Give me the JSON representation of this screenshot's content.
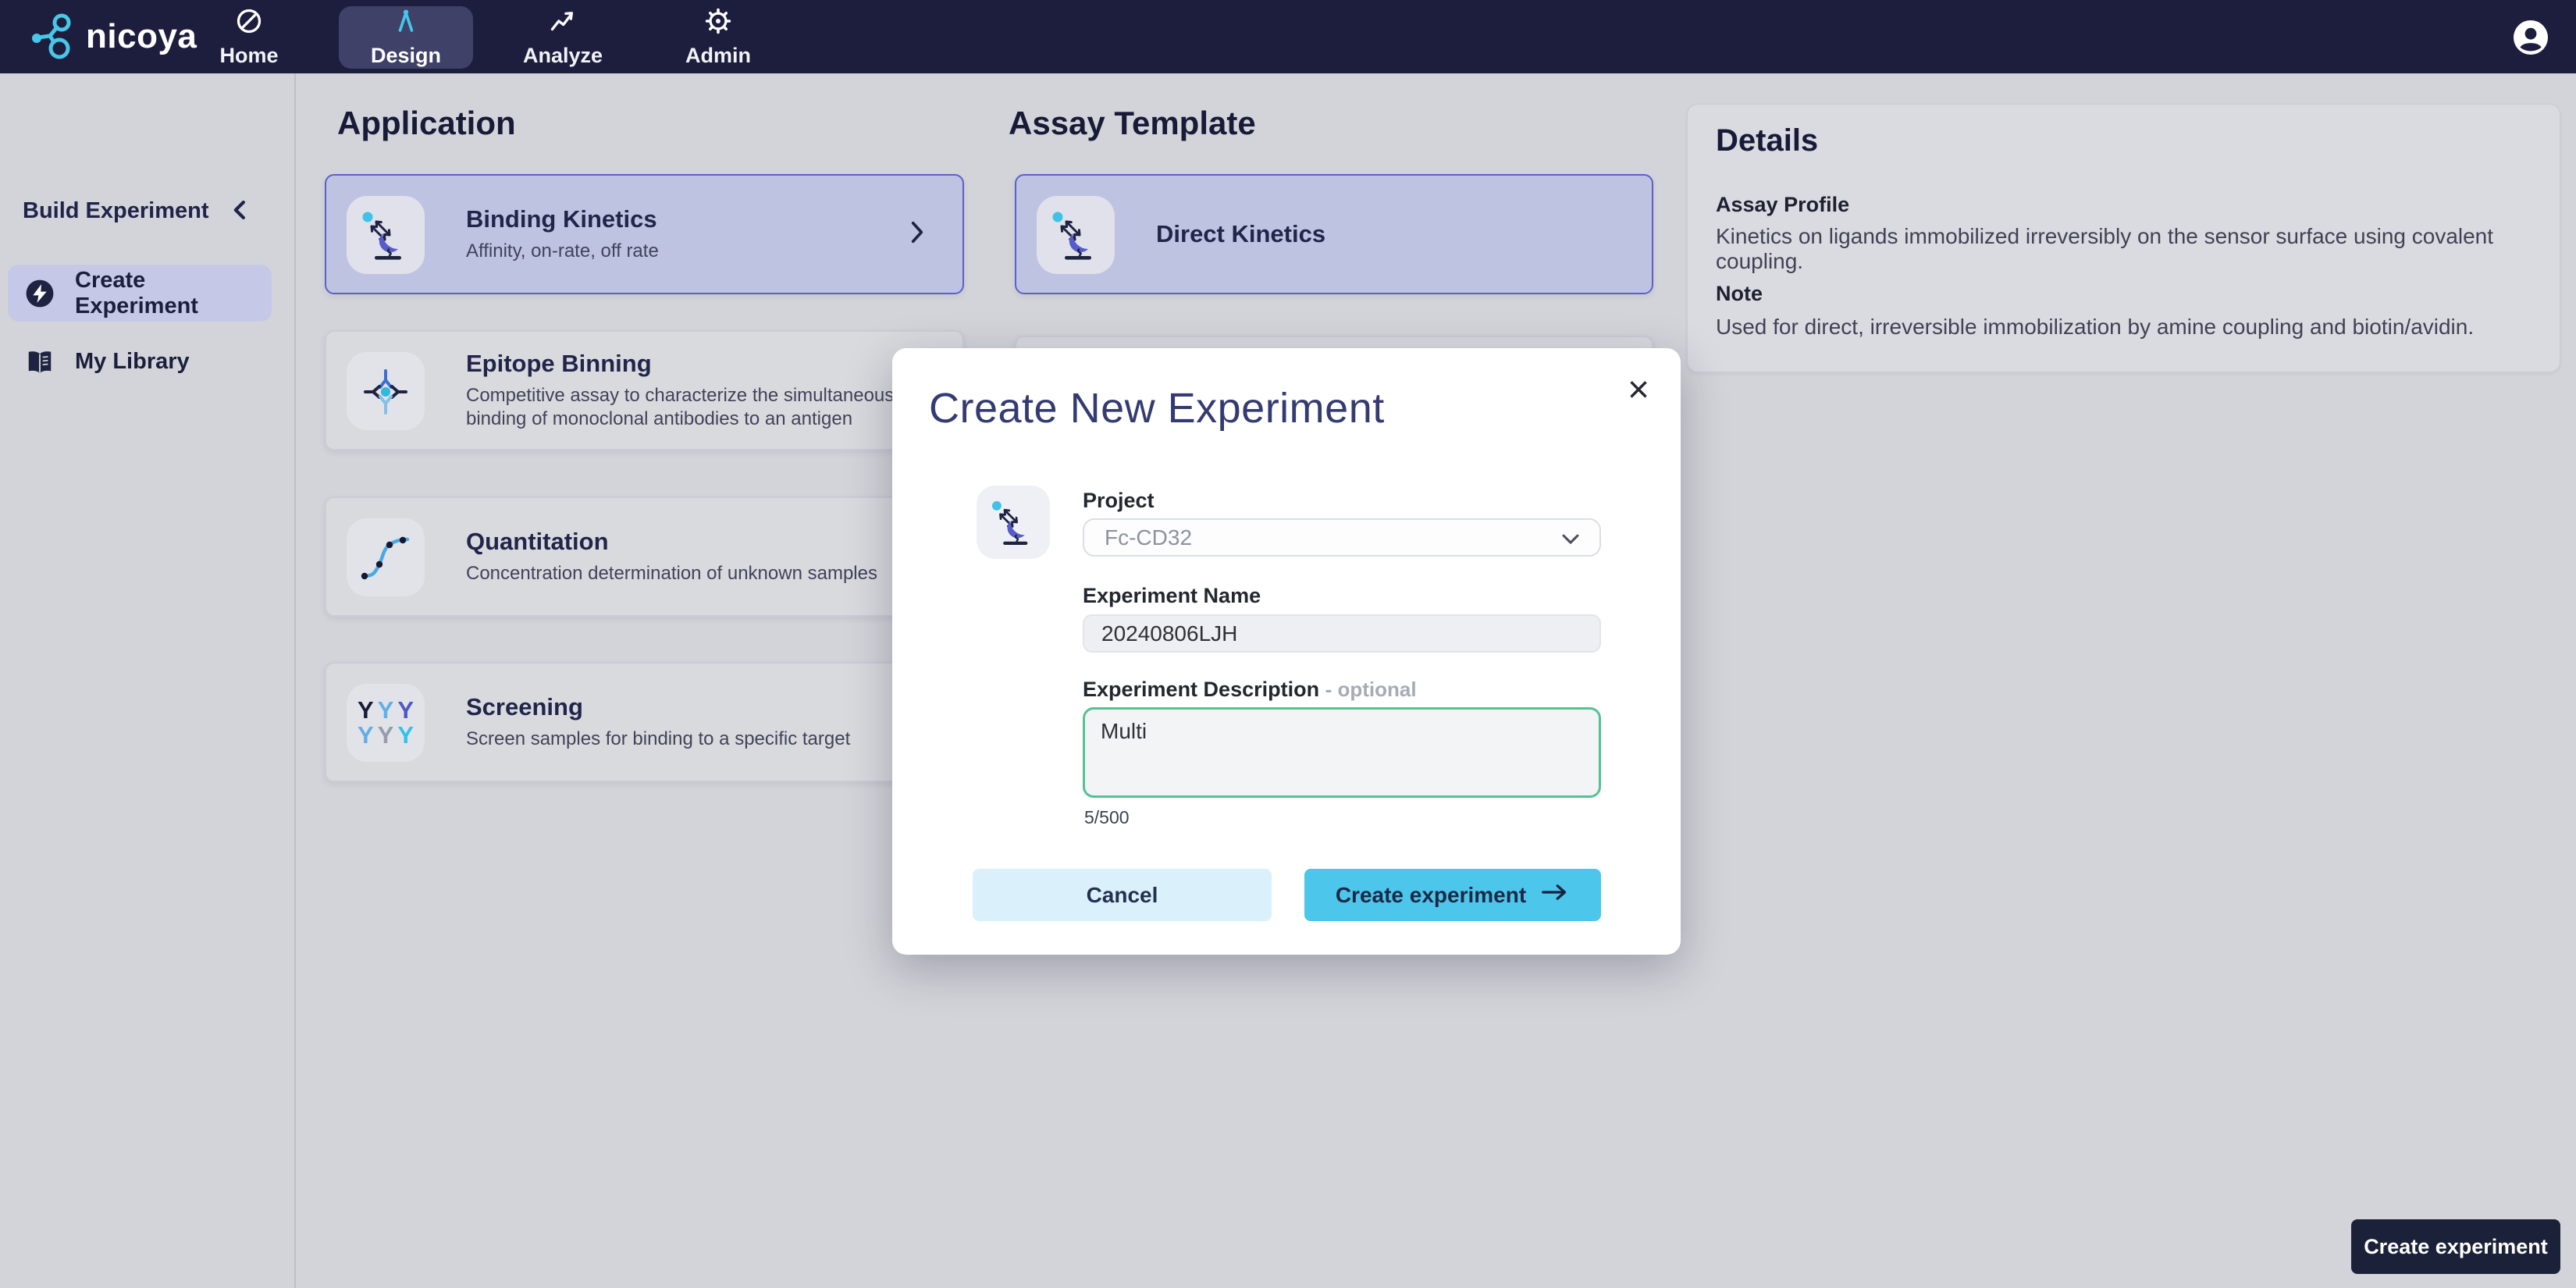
{
  "nav": {
    "brand": "nicoya",
    "items": [
      {
        "label": "Home",
        "active": false
      },
      {
        "label": "Design",
        "active": true
      },
      {
        "label": "Analyze",
        "active": false
      },
      {
        "label": "Admin",
        "active": false
      }
    ]
  },
  "sidebar": {
    "title": "Build Experiment",
    "items": [
      {
        "label": "Create Experiment",
        "active": true
      },
      {
        "label": "My Library",
        "active": false
      }
    ]
  },
  "application": {
    "heading": "Application",
    "cards": [
      {
        "title": "Binding Kinetics",
        "desc": "Affinity, on-rate, off rate",
        "selected": true
      },
      {
        "title": "Epitope Binning",
        "desc": "Competitive assay to characterize the simultaneous binding of monoclonal antibodies to an antigen",
        "selected": false
      },
      {
        "title": "Quantitation",
        "desc": "Concentration determination of unknown samples",
        "selected": false
      },
      {
        "title": "Screening",
        "desc": "Screen samples for binding to a specific target",
        "selected": false
      }
    ]
  },
  "assay_template": {
    "heading": "Assay Template",
    "cards": [
      {
        "title": "Direct Kinetics",
        "selected": true
      }
    ]
  },
  "details": {
    "heading": "Details",
    "sections": [
      {
        "label": "Assay Profile",
        "body": "Kinetics on ligands immobilized irreversibly on the sensor surface using covalent coupling."
      },
      {
        "label": "Note",
        "body": "Used for direct, irreversible immobilization by amine coupling and biotin/avidin."
      }
    ]
  },
  "modal": {
    "title": "Create New Experiment",
    "close_icon": "×",
    "project_label": "Project",
    "project_value": "Fc-CD32",
    "name_label": "Experiment Name",
    "name_value": "20240806LJH",
    "desc_label": "Experiment Description",
    "desc_optional": "- optional",
    "desc_value": "Multi",
    "char_count": "5/500",
    "cancel_label": "Cancel",
    "submit_label": "Create experiment"
  },
  "footer": {
    "create_label": "Create experiment"
  },
  "icons": {
    "screening_glyph": "Y"
  },
  "colors": {
    "navbar": "#1d1e3e",
    "accent_cyan": "#45c7e9",
    "selection_indigo": "#5a61c9",
    "textarea_green": "#57c193",
    "submit_blue": "#4cc6ea",
    "cancel_light_blue": "#daf1fb",
    "footer_navy": "#1b2138"
  }
}
